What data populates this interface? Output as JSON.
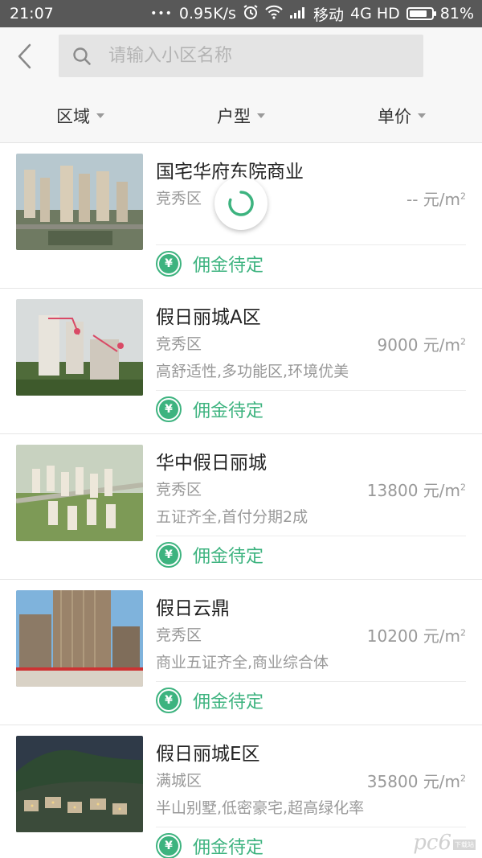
{
  "status_bar": {
    "time": "21:07",
    "dots": "•••",
    "network_speed": "0.95K/s",
    "carrier": "移动",
    "network_type": "4G HD",
    "battery_percent": "81%",
    "battery_level": 0.81
  },
  "header": {
    "search": {
      "placeholder": "请输入小区名称",
      "value": ""
    }
  },
  "filters": [
    {
      "label": "区域"
    },
    {
      "label": "户型"
    },
    {
      "label": "单价"
    }
  ],
  "listings": [
    {
      "name": "国宅华府东院商业",
      "district": "竞秀区",
      "price": "-- 元/m",
      "price_unit_sup": "2",
      "feature": "",
      "commission": "佣金待定"
    },
    {
      "name": "假日丽城A区",
      "district": "竞秀区",
      "price": "9000 元/m",
      "price_unit_sup": "2",
      "feature": "高舒适性,多功能区,环境优美",
      "commission": "佣金待定"
    },
    {
      "name": "华中假日丽城",
      "district": "竞秀区",
      "price": "13800 元/m",
      "price_unit_sup": "2",
      "feature": "五证齐全,首付分期2成",
      "commission": "佣金待定"
    },
    {
      "name": "假日云鼎",
      "district": "竞秀区",
      "price": "10200 元/m",
      "price_unit_sup": "2",
      "feature": "商业五证齐全,商业综合体",
      "commission": "佣金待定"
    },
    {
      "name": "假日丽城E区",
      "district": "满城区",
      "price": "35800 元/m",
      "price_unit_sup": "2",
      "feature": "半山别墅,低密豪宅,超高绿化率",
      "commission": "佣金待定"
    }
  ],
  "colors": {
    "accent": "#3db37f",
    "status_bar": "#585858",
    "header_bg": "#f7f7f7"
  },
  "watermark": {
    "main": "pc6",
    "sub": "下载站"
  }
}
